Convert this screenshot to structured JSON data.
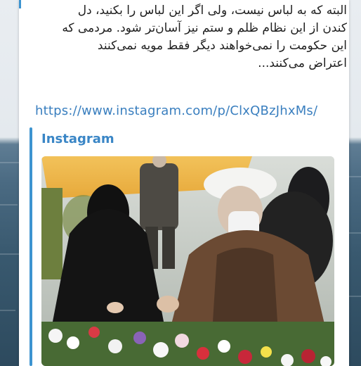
{
  "post": {
    "text_lines": [
      "البته که به لباس نیست، ولی اگر این لباس را بکنید، دل",
      "کندن از این نظام ظلم و ستم نیز آسان‌تر شود. مردمی که",
      "این حکومت را نمی‌خواهند دیگر فقط مویه نمی‌کنند",
      "اعتراض می‌کنند..."
    ],
    "link": "https://www.instagram.com/p/ClxQBzJhxMs/"
  },
  "preview": {
    "site_name": "Instagram",
    "image_alt_icon": "photo-image"
  },
  "colors": {
    "accent": "#3d94d0",
    "link": "#3a7fbf",
    "text": "#1f1f1f"
  }
}
